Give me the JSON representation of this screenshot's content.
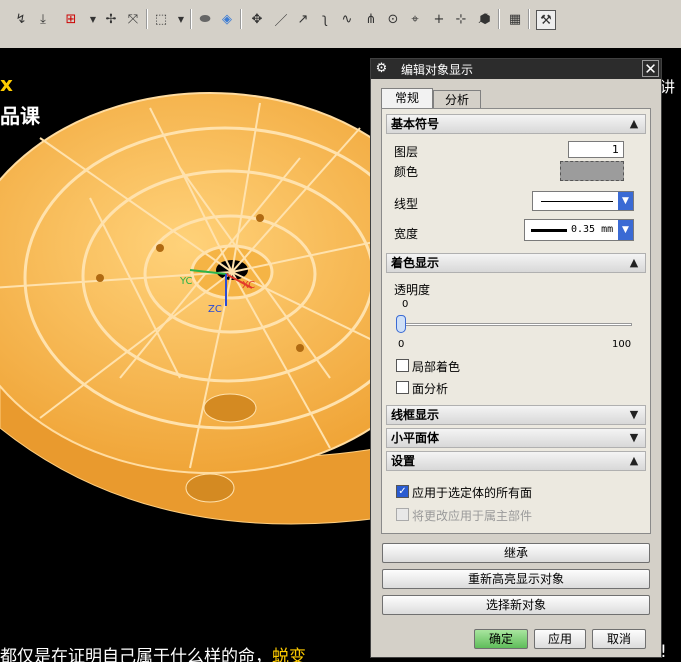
{
  "viewport": {
    "brand_line1": "x",
    "brand_line2": "品课",
    "right_text": "讲",
    "subtitle_before": "都仅是在证明自己属于什么样的命，",
    "subtitle_highlight": "蜕变",
    "subtitle_end": "!",
    "axis_yc": "YC",
    "axis_xc": "XC",
    "axis_zc": "ZC"
  },
  "dialog": {
    "title": "编辑对象显示",
    "close": "✕",
    "tabs": [
      {
        "label": "常规"
      },
      {
        "label": "分析"
      }
    ],
    "basic": {
      "header": "基本符号",
      "layer_label": "图层",
      "layer_value": "1",
      "color_label": "颜色",
      "linetype_label": "线型",
      "width_label": "宽度",
      "width_value": "0.35 mm"
    },
    "shading": {
      "header": "着色显示",
      "transparency_label": "透明度",
      "transparency_value": "0",
      "slider_min": "0",
      "slider_max": "100",
      "partial_shading_label": "局部着色",
      "face_analysis_label": "面分析"
    },
    "wireframe": {
      "header": "线框显示"
    },
    "facets": {
      "header": "小平面体"
    },
    "settings": {
      "header": "设置",
      "apply_all_faces_label": "应用于选定体的所有面",
      "apply_all_faces_checked": true,
      "apply_owner_label": "将更改应用于属主部件"
    },
    "buttons": {
      "inherit": "继承",
      "rehighlight": "重新高亮显示对象",
      "reselect": "选择新对象",
      "ok": "确定",
      "apply": "应用",
      "cancel": "取消"
    }
  },
  "colors": {
    "model": "#f5b445",
    "arrow": "#e8302a",
    "titlebar": "#2c2c2c"
  }
}
